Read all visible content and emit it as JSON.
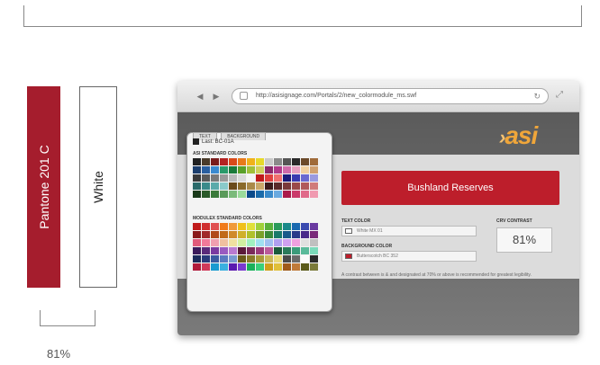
{
  "swatches": {
    "primary": {
      "label": "Pantone 201 C",
      "color": "#a51d2d"
    },
    "secondary": {
      "label": "White",
      "color": "#ffffff"
    },
    "contrast": "81%"
  },
  "browser": {
    "url": "http://asisignage.com/Portals/2/new_colormodule_ms.swf",
    "logo": "asi",
    "picker": {
      "tabs": [
        "TEXT",
        "BACKGROUND"
      ],
      "last_label": "Last: BC-01A",
      "asi_title": "ASI STANDARD COLORS",
      "modulex_title": "MODULEX STANDARD COLORS"
    },
    "preview_text": "Bushland Reserves",
    "text_color_label": "TEXT COLOR",
    "text_color_value": "White MX 01",
    "background_color_label": "BACKGROUND COLOR",
    "background_color_value": "Butterscotch BC 352",
    "contrast_label": "CRV CONTRAST",
    "contrast_value": "81%",
    "note": "A contrast between is & and designated at 70% or above is recommended for greatest legibility."
  }
}
